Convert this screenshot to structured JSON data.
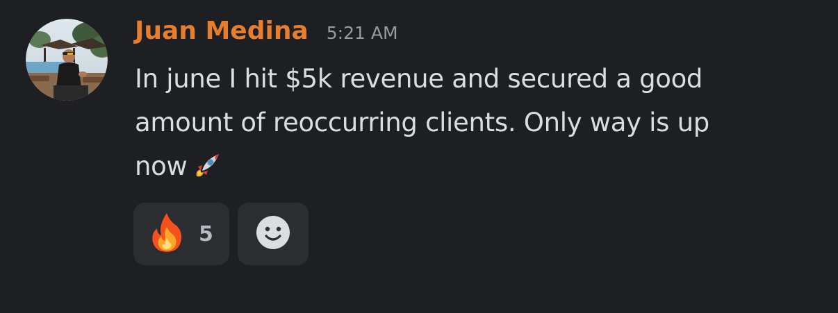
{
  "message": {
    "author": "Juan Medina",
    "timestamp": "5:21 AM",
    "author_color": "#e67e2e",
    "avatar_icon": "user-avatar-photo",
    "content_lines": [
      "In june I hit $5k revenue and secured a good",
      "amount of reoccurring clients. Only way is up",
      "now"
    ],
    "content_emoji": "rocket-emoji"
  },
  "reactions": [
    {
      "emoji": "fire-emoji",
      "count": "5"
    }
  ],
  "add_reaction": {
    "icon": "smiley-icon"
  },
  "colors": {
    "background": "#1e1f22",
    "reaction_bg": "#2b2d31",
    "text": "#dbdee1",
    "muted": "#949ba4"
  }
}
